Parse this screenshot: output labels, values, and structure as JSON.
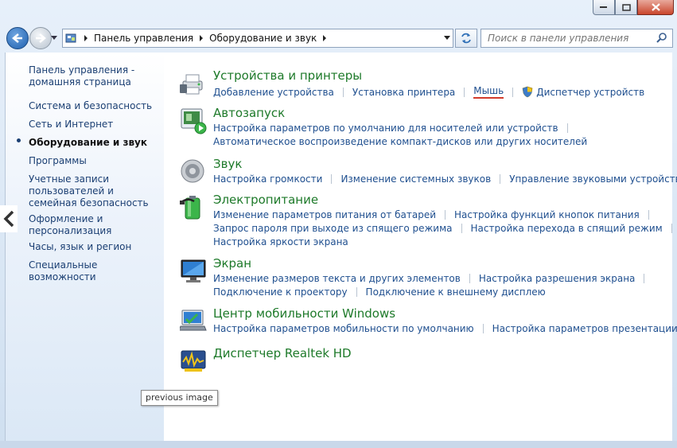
{
  "nav": {
    "breadcrumb": [
      "Панель управления",
      "Оборудование и звук"
    ],
    "search_placeholder": "Поиск в панели управления"
  },
  "sidebar": {
    "items": [
      {
        "label": "Панель управления - домашняя страница"
      },
      {
        "label": "Система и безопасность"
      },
      {
        "label": "Сеть и Интернет"
      },
      {
        "label": "Оборудование и звук",
        "current": true
      },
      {
        "label": "Программы"
      },
      {
        "label": "Учетные записи пользователей и семейная безопасность"
      },
      {
        "label": "Оформление и персонализация"
      },
      {
        "label": "Часы, язык и регион"
      },
      {
        "label": "Специальные возможности"
      }
    ]
  },
  "categories": [
    {
      "title": "Устройства и принтеры",
      "icon": "printer-icon",
      "rows": [
        [
          "Добавление устройства",
          "Установка принтера",
          "Мышь",
          "Диспетчер устройств"
        ]
      ]
    },
    {
      "title": "Автозапуск",
      "icon": "autoplay-icon",
      "rows": [
        [
          "Настройка параметров по умолчанию для носителей или устройств"
        ],
        [
          "Автоматическое воспроизведение компакт-дисков или других носителей"
        ]
      ]
    },
    {
      "title": "Звук",
      "icon": "speaker-icon",
      "rows": [
        [
          "Настройка громкости",
          "Изменение системных звуков",
          "Управление звуковыми устройствами"
        ]
      ]
    },
    {
      "title": "Электропитание",
      "icon": "battery-icon",
      "rows": [
        [
          "Изменение параметров питания от батарей",
          "Настройка функций кнопок питания"
        ],
        [
          "Запрос пароля при выходе из спящего режима",
          "Настройка перехода в спящий режим"
        ],
        [
          "Настройка яркости экрана"
        ]
      ]
    },
    {
      "title": "Экран",
      "icon": "monitor-icon",
      "rows": [
        [
          "Изменение размеров текста и других элементов",
          "Настройка разрешения экрана"
        ],
        [
          "Подключение к проектору",
          "Подключение к внешнему дисплею"
        ]
      ]
    },
    {
      "title": "Центр мобильности Windows",
      "icon": "mobility-center-icon",
      "rows": [
        [
          "Настройка параметров мобильности по умолчанию",
          "Настройка параметров презентации"
        ]
      ]
    },
    {
      "title": "Диспетчер Realtek HD",
      "icon": "realtek-icon",
      "rows": []
    }
  ],
  "overlay": {
    "tooltip": "previous image",
    "prev_arrow": "<"
  },
  "colors": {
    "link": "#1f4f8f",
    "category_title": "#1e7a2a",
    "highlight_underline": "#d23b2b"
  }
}
